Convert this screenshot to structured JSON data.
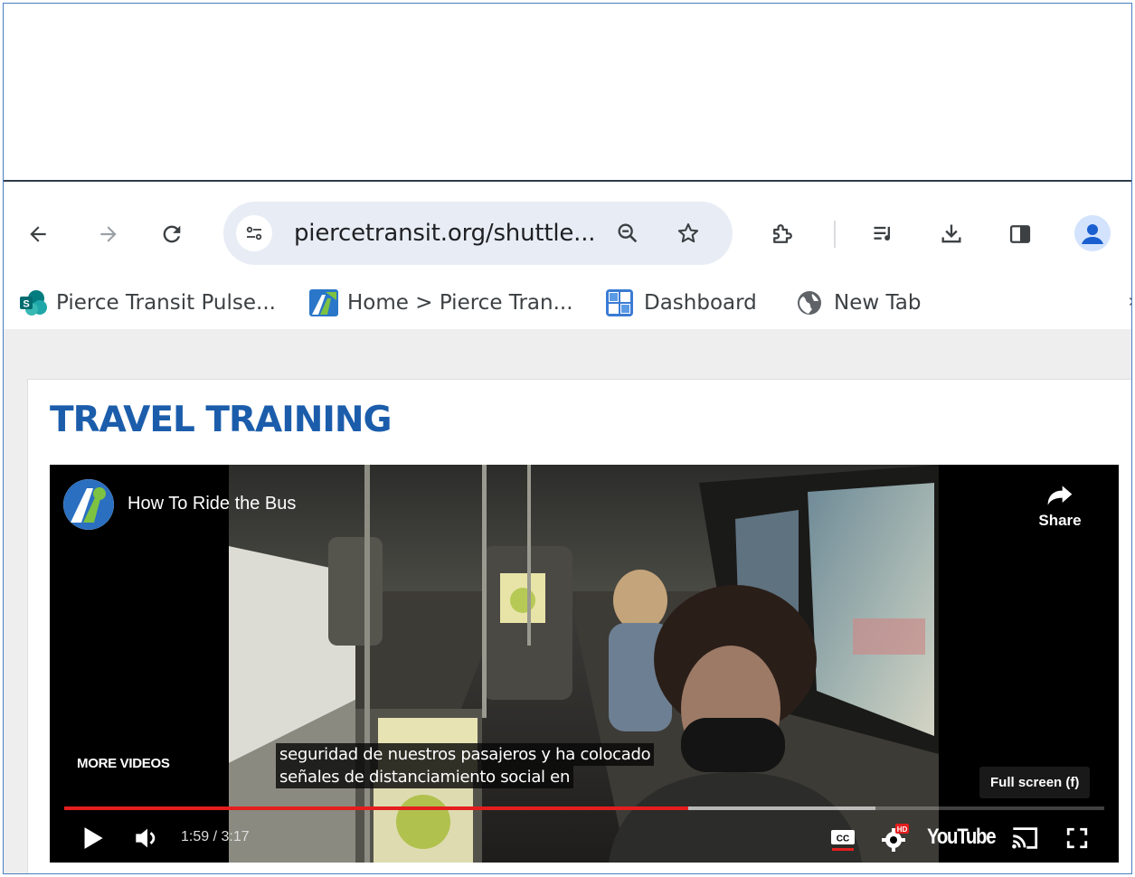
{
  "browser": {
    "nav": {
      "back_icon": "arrow-left-icon",
      "forward_icon": "arrow-right-icon",
      "reload_icon": "reload-icon"
    },
    "omnibox": {
      "url": "piercetransit.org/shuttle...",
      "site_info_icon": "tune-icon",
      "zoom_icon": "zoom-out-icon",
      "bookmark_icon": "star-icon"
    },
    "toolbar_icons": [
      "puzzle-extensions-icon",
      "media-queue-icon",
      "download-icon",
      "side-panel-icon",
      "profile-avatar-icon"
    ],
    "bookmarks": [
      {
        "label": "Pierce Transit Pulse...",
        "icon": "sharepoint-icon"
      },
      {
        "label": "Home > Pierce Tran...",
        "icon": "pierce-transit-logo-icon"
      },
      {
        "label": "Dashboard",
        "icon": "dashboard-grid-icon"
      },
      {
        "label": "New Tab",
        "icon": "globe-icon"
      }
    ],
    "bookmarks_overflow": "›"
  },
  "page": {
    "heading": "TRAVEL TRAINING"
  },
  "video": {
    "title": "How To Ride the Bus",
    "share_label": "Share",
    "more_videos_label": "MORE VIDEOS",
    "caption_lines": [
      "seguridad de nuestros pasajeros y ha colocado",
      "señales de distanciamiento social en"
    ],
    "tooltip": "Full screen (f)",
    "time_display": "1:59 / 3:17",
    "played_fraction": 0.6,
    "buffered_fraction": 0.78,
    "youtube_wordmark": "YouTube",
    "hd_badge": "HD",
    "cc_label": "CC",
    "colors": {
      "progress": "#e41e1e",
      "heading": "#1b5dab"
    }
  }
}
